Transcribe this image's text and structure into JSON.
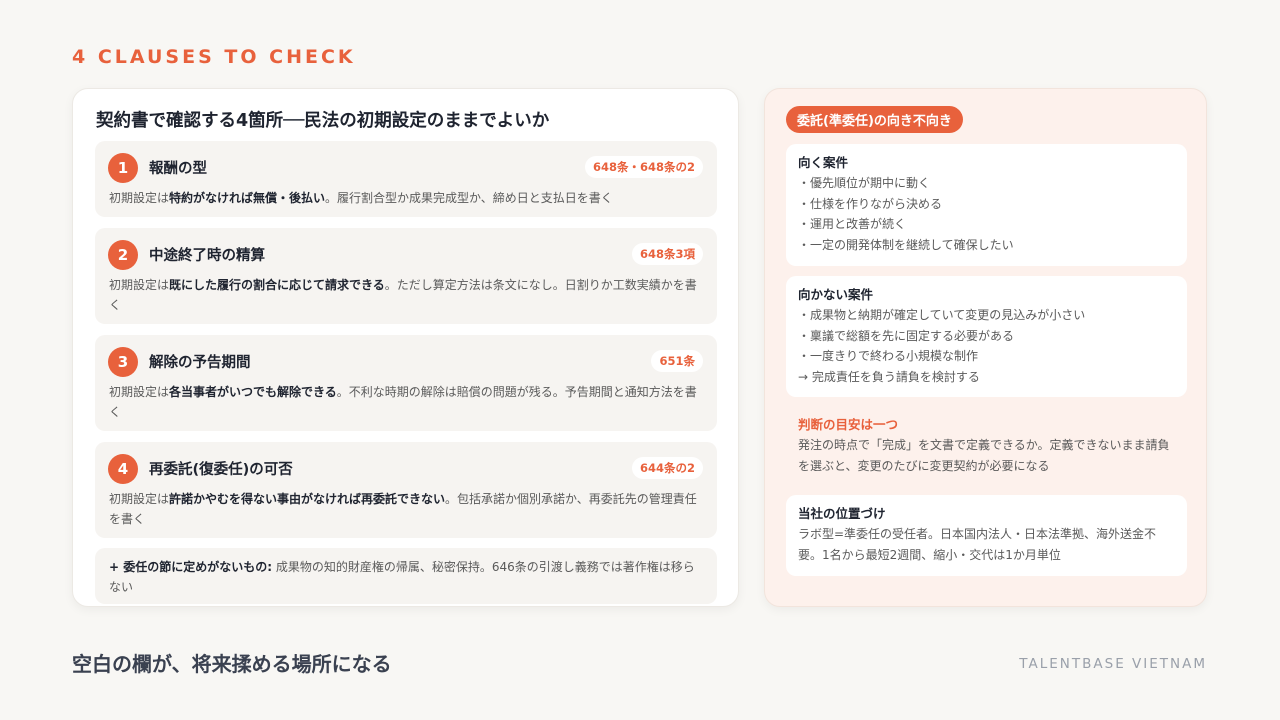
{
  "eyebrow": "4 CLAUSES TO CHECK",
  "left": {
    "title": "契約書で確認する4箇所──民法の初期設定のままでよいか",
    "clauses": [
      {
        "num": "1",
        "title": "報酬の型",
        "article": "648条・648条の2",
        "desc_pre": "初期設定は",
        "desc_bold": "特約がなければ無償・後払い",
        "desc_post": "。履行割合型か成果完成型か、締め日と支払日を書く"
      },
      {
        "num": "2",
        "title": "中途終了時の精算",
        "article": "648条3項",
        "desc_pre": "初期設定は",
        "desc_bold": "既にした履行の割合に応じて請求できる",
        "desc_post": "。ただし算定方法は条文になし。日割りか工数実績かを書く"
      },
      {
        "num": "3",
        "title": "解除の予告期間",
        "article": "651条",
        "desc_pre": "初期設定は",
        "desc_bold": "各当事者がいつでも解除できる",
        "desc_post": "。不利な時期の解除は賠償の問題が残る。予告期間と通知方法を書く"
      },
      {
        "num": "4",
        "title": "再委託(復委任)の可否",
        "article": "644条の2",
        "desc_pre": "初期設定は",
        "desc_bold": "許諾かやむを得ない事由がなければ再委託できない",
        "desc_post": "。包括承諾か個別承諾か、再委託先の管理責任を書く"
      }
    ],
    "note_bold": "+ 委任の節に定めがないもの:",
    "note_text": " 成果物の知的財産権の帰属、秘密保持。646条の引渡し義務では著作権は移らない"
  },
  "right": {
    "pill": "委託(準委任)の向き不向き",
    "suited_title": "向く案件",
    "suited": [
      "・優先順位が期中に動く",
      "・仕様を作りながら決める",
      "・運用と改善が続く",
      "・一定の開発体制を継続して確保したい"
    ],
    "unsuited_title": "向かない案件",
    "unsuited": [
      "・成果物と納期が確定していて変更の見込みが小さい",
      "・稟議で総額を先に固定する必要がある",
      "・一度きりで終わる小規模な制作",
      "→ 完成責任を負う請負を検討する"
    ],
    "judge_title": "判断の目安は一つ",
    "judge_text": "発注の時点で「完成」を文書で定義できるか。定義できないまま請負を選ぶと、変更のたびに変更契約が必要になる",
    "position_title": "当社の位置づけ",
    "position_text": "ラボ型=準委任の受任者。日本国内法人・日本法準拠、海外送金不要。1名から最短2週間、縮小・交代は1か月単位"
  },
  "footer": {
    "message": "空白の欄が、将来揉める場所になる",
    "brand": "TALENTBASE VIETNAM"
  },
  "colors": {
    "accent": "#e8613c",
    "background": "#f8f7f4",
    "right_panel": "#fdf1ec"
  }
}
